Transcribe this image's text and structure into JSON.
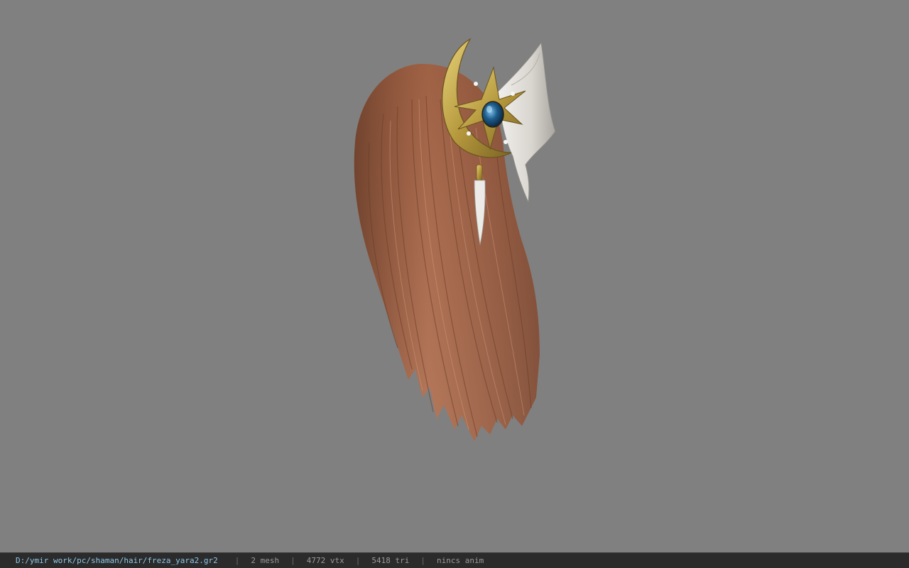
{
  "viewport": {
    "background": "#808080",
    "model": {
      "kind": "3d-hair-model-render",
      "hair_color": "#b0704e",
      "ornament": "crescent-moon-sun-hairpin",
      "gem_color": "#1d5c8c"
    }
  },
  "status_bar": {
    "file_path": "D:/ymir work/pc/shaman/hair/freza_yara2.gr2",
    "separator": "|",
    "mesh_count": "2 mesh",
    "vertex_count": "4772 vtx",
    "triangle_count": "5418 tri",
    "anim_status": "nincs anim"
  }
}
